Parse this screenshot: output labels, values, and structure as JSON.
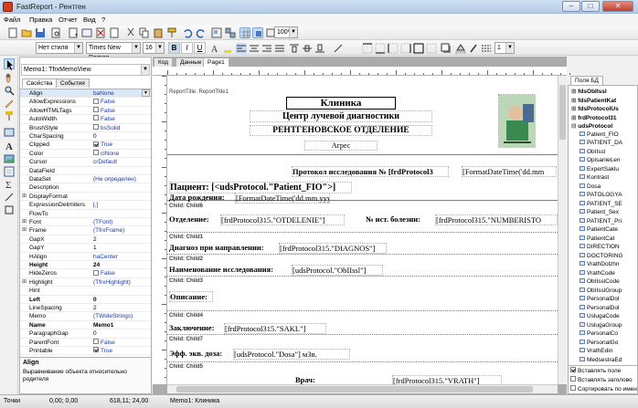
{
  "window": {
    "title": "FastReport - Рентген"
  },
  "menu": [
    "Файл",
    "Правка",
    "Отчет",
    "Вид",
    "?"
  ],
  "format_bar": {
    "style": "Нет стиля",
    "font": "Times New Roman",
    "size": "16",
    "zoom": "100%",
    "line_width": "1"
  },
  "inspector": {
    "object": "Memo1: TfrxMemoView",
    "tabs": [
      "Свойства",
      "События"
    ],
    "rows": [
      {
        "name": "Align",
        "value": "baNone",
        "bold": false
      },
      {
        "name": "AllowExpressions",
        "value": "False",
        "chk": true,
        "on": false
      },
      {
        "name": "AllowHTMLTags",
        "value": "False",
        "chk": true,
        "on": false
      },
      {
        "name": "AutoWidth",
        "value": "False",
        "chk": true,
        "on": false
      },
      {
        "name": "BrushStyle",
        "value": "bsSolid",
        "sq": true
      },
      {
        "name": "CharSpacing",
        "value": "0",
        "blk": true
      },
      {
        "name": "Clipped",
        "value": "True",
        "chk": true,
        "on": true
      },
      {
        "name": "Color",
        "value": "clNone",
        "sq": true
      },
      {
        "name": "Cursor",
        "value": "crDefault"
      },
      {
        "name": "DataField",
        "value": ""
      },
      {
        "name": "DataSet",
        "value": "(Не определен)"
      },
      {
        "name": "Description",
        "value": ""
      },
      {
        "name": "DisplayFormat",
        "value": "",
        "plus": true
      },
      {
        "name": "ExpressionDelimiters",
        "value": "[,]"
      },
      {
        "name": "FlowTo",
        "value": ""
      },
      {
        "name": "Font",
        "value": "(TFont)",
        "plus": true
      },
      {
        "name": "Frame",
        "value": "(TfrxFrame)",
        "plus": true
      },
      {
        "name": "GapX",
        "value": "2",
        "blk": true
      },
      {
        "name": "GapY",
        "value": "1",
        "blk": true
      },
      {
        "name": "HAlign",
        "value": "haCenter"
      },
      {
        "name": "Height",
        "value": "24",
        "bold": true
      },
      {
        "name": "HideZeros",
        "value": "False",
        "chk": true,
        "on": false
      },
      {
        "name": "Highlight",
        "value": "(TfrxHighlight)",
        "plus": true
      },
      {
        "name": "Hint",
        "value": ""
      },
      {
        "name": "Left",
        "value": "0",
        "bold": true
      },
      {
        "name": "LineSpacing",
        "value": "2",
        "blk": true
      },
      {
        "name": "Memo",
        "value": "(TWideStrings)"
      },
      {
        "name": "Name",
        "value": "Memo1",
        "bold": true
      },
      {
        "name": "ParagraphGap",
        "value": "0",
        "blk": true
      },
      {
        "name": "ParentFont",
        "value": "False",
        "chk": true,
        "on": false
      },
      {
        "name": "Printable",
        "value": "True",
        "chk": true,
        "on": true
      }
    ],
    "help_title": "Align",
    "help_text": "Выравнивание объекта относительно родителя"
  },
  "designer_tabs": [
    "Код",
    "Данные",
    "Page1"
  ],
  "report": {
    "title_band": "ReportTitle: ReportTitle1",
    "clinic": "Клиника",
    "center": "Центр лучевой диагностики",
    "dept": "РЕНТГЕНОВСКОЕ   ОТДЕЛЕНИЕ",
    "address": "Агрес",
    "protocol": "Протокол исследования № [frdProtocol3",
    "date_fmt": "[FormatDateTime('dd.mm",
    "patient": "Пациент: [<udsProtocol.\"Patient_FIO\">]",
    "birth_lbl": "Дата рождения:",
    "birth_val": "[FormatDateTime('dd.mm.yyy",
    "child6": "Child: Child6",
    "otd_lbl": "Отделение:",
    "otd_val": "[frdProtocol315.\"OTDELENIE\"]",
    "hist_lbl": "№ ист. болезни:",
    "hist_val": "[frdProtocol315.\"NUMBERISTO",
    "child1": "Child: Child1",
    "diag_lbl": "Диагноз при направлении:",
    "diag_val": "[frdProtocol315.\"DIAGNOS\"]",
    "child2": "Child: Child2",
    "name_lbl": "Наименование исследования:",
    "name_val": "[udsProtocol.\"ObIIssl\"]",
    "child3": "Child: Child3",
    "desc_lbl": "Описание:",
    "child4": "Child: Child4",
    "concl_lbl": "Заключение:",
    "concl_val": "[frdProtocol315.\"SAKL\"]",
    "child7": "Child: Child7",
    "dose_lbl": "Эфф. экв. доза:",
    "dose_val": "[udsProtocol.\"Dosa\"] мЗв.",
    "child5": "Child: Child5",
    "doctor_lbl": "Врач:",
    "doctor_val": "[frdProtocol315.\"VRATH\"]"
  },
  "right_panel": {
    "tab": "Поля БД",
    "bold_items": [
      "fdsObIIssl",
      "fdsPatientKat",
      "fdsProtocolUs",
      "frdProtocol31",
      "udsProtocol"
    ],
    "items": [
      "Patient_FIO",
      "PATIENT_DA",
      "ObIIssl",
      "OpisanieLen",
      "ExpertSaklu",
      "Kontrast",
      "Dosa",
      "PATOLOGYA",
      "PATIENT_SE",
      "Patient_Sex",
      "PATIENT_Pri",
      "PatientCate",
      "PatientCat",
      "DIRECTION",
      "DOCTORING",
      "VrathDolzhn",
      "VrathCode",
      "ObIIsslCode",
      "ObIIsslGroup",
      "PersonalDol",
      "PersonalDol",
      "UslugaCode",
      "UslugaGroup",
      "PersonalCo",
      "PersonalGo",
      "VrathEdin",
      "MedsestraEd"
    ],
    "checks": [
      {
        "label": "Вставлять поле",
        "on": true
      },
      {
        "label": "Вставлять заголово",
        "on": false
      },
      {
        "label": "Сортировать по имен",
        "on": false
      }
    ]
  },
  "status": {
    "units": "Точки",
    "pos": "0,00; 0,00",
    "size": "618,11; 24,00",
    "object": "Memo1: Клиника"
  }
}
